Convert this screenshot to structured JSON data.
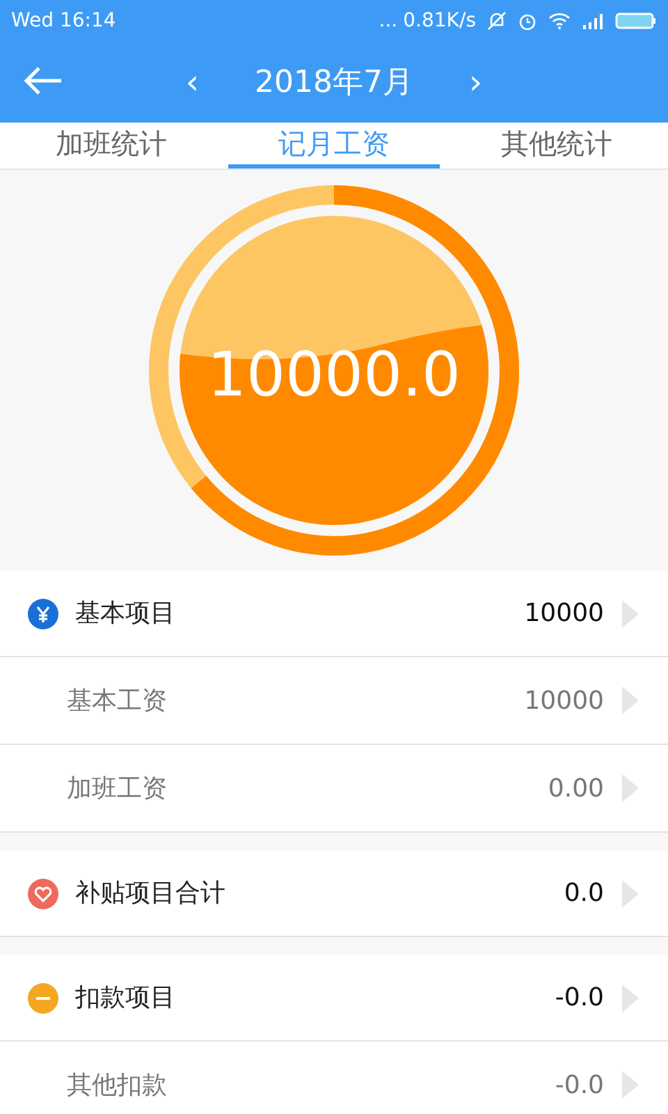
{
  "status_bar": {
    "time": "Wed 16:14",
    "dots": "...",
    "speed": "0.81K/s"
  },
  "header": {
    "prev": "‹",
    "title": "2018年7月",
    "next": "›"
  },
  "tabs": [
    {
      "label": "加班统计",
      "selected": false
    },
    {
      "label": "记月工资",
      "selected": true
    },
    {
      "label": "其他统计",
      "selected": false
    }
  ],
  "gauge": {
    "value": "10000.0",
    "level": 0.64
  },
  "sections": [
    {
      "kind": "basic",
      "label": "基本项目",
      "value": "10000",
      "items": [
        {
          "label": "基本工资",
          "value": "10000"
        },
        {
          "label": "加班工资",
          "value": "0.00"
        }
      ]
    },
    {
      "kind": "subsidy",
      "label": "补贴项目合计",
      "value": "0.0"
    },
    {
      "kind": "deduction",
      "label": "扣款项目",
      "value": "-0.0",
      "items": [
        {
          "label": "其他扣款",
          "value": "-0.0"
        }
      ]
    }
  ]
}
